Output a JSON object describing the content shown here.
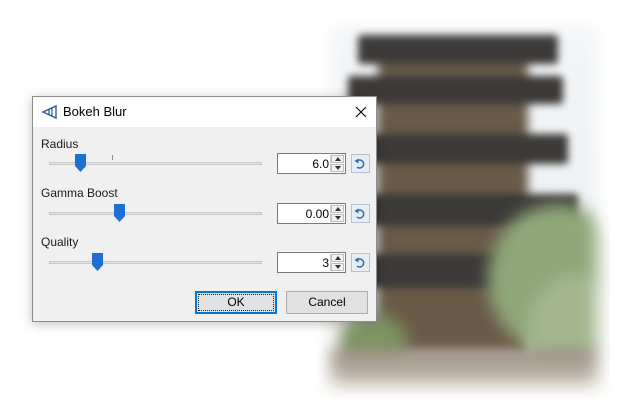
{
  "dialog": {
    "title": "Bokeh Blur",
    "icon": "bokeh-blur-effect-icon",
    "close_icon": "close-icon"
  },
  "controls": [
    {
      "label": "Radius",
      "value": "6.0",
      "slider_fraction": 0.15,
      "has_default_tick": true
    },
    {
      "label": "Gamma Boost",
      "value": "0.00",
      "slider_fraction": 0.33,
      "has_default_tick": false
    },
    {
      "label": "Quality",
      "value": "3",
      "slider_fraction": 0.23,
      "has_default_tick": false
    }
  ],
  "buttons": {
    "ok": "OK",
    "cancel": "Cancel"
  },
  "colors": {
    "accent": "#0078d7",
    "thumb": "#1e6fd0",
    "dialog_bg": "#f0f0f0"
  }
}
